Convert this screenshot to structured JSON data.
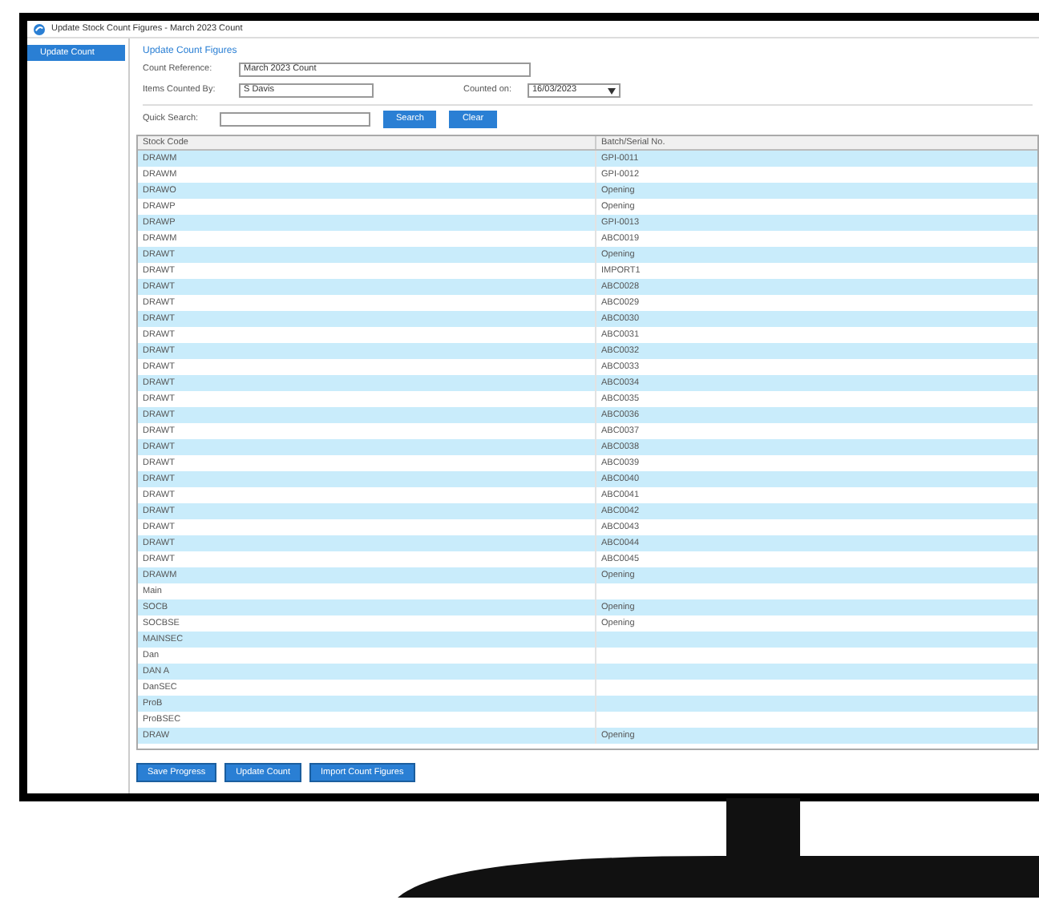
{
  "window": {
    "title": "Update Stock Count Figures - March 2023 Count"
  },
  "sidebar": {
    "items": [
      {
        "label": "Update Count",
        "selected": true
      }
    ]
  },
  "form": {
    "heading": "Update Count Figures",
    "count_reference": {
      "label": "Count Reference:",
      "value": "March 2023 Count"
    },
    "items_counted_by": {
      "label": "Items Counted By:",
      "value": "S Davis"
    },
    "counted_on": {
      "label": "Counted on:",
      "value": "16/03/2023"
    },
    "quick_search": {
      "label": "Quick Search:"
    },
    "buttons": [
      "Search",
      "Clear"
    ]
  },
  "table": {
    "columns": [
      "Stock Code",
      "Batch/Serial No."
    ],
    "rows": [
      [
        "DRAWM",
        "GPI-0011"
      ],
      [
        "DRAWM",
        "GPI-0012"
      ],
      [
        "DRAWO",
        "Opening"
      ],
      [
        "DRAWP",
        "Opening"
      ],
      [
        "DRAWP",
        "GPI-0013"
      ],
      [
        "DRAWM",
        "ABC0019"
      ],
      [
        "DRAWT",
        "Opening"
      ],
      [
        "DRAWT",
        "IMPORT1"
      ],
      [
        "DRAWT",
        "ABC0028"
      ],
      [
        "DRAWT",
        "ABC0029"
      ],
      [
        "DRAWT",
        "ABC0030"
      ],
      [
        "DRAWT",
        "ABC0031"
      ],
      [
        "DRAWT",
        "ABC0032"
      ],
      [
        "DRAWT",
        "ABC0033"
      ],
      [
        "DRAWT",
        "ABC0034"
      ],
      [
        "DRAWT",
        "ABC0035"
      ],
      [
        "DRAWT",
        "ABC0036"
      ],
      [
        "DRAWT",
        "ABC0037"
      ],
      [
        "DRAWT",
        "ABC0038"
      ],
      [
        "DRAWT",
        "ABC0039"
      ],
      [
        "DRAWT",
        "ABC0040"
      ],
      [
        "DRAWT",
        "ABC0041"
      ],
      [
        "DRAWT",
        "ABC0042"
      ],
      [
        "DRAWT",
        "ABC0043"
      ],
      [
        "DRAWT",
        "ABC0044"
      ],
      [
        "DRAWT",
        "ABC0045"
      ],
      [
        "DRAWM",
        "Opening"
      ],
      [
        "Main",
        null
      ],
      [
        "SOCB",
        "Opening"
      ],
      [
        "SOCBSE",
        "Opening"
      ],
      [
        "MAINSEC",
        null
      ],
      [
        "Dan",
        null
      ],
      [
        "DAN A",
        null
      ],
      [
        "DanSEC",
        null
      ],
      [
        "ProB",
        null
      ],
      [
        "ProBSEC",
        null
      ],
      [
        "DRAW",
        "Opening"
      ]
    ]
  },
  "footer_buttons": [
    "Save Progress",
    "Update Count",
    "Import Count Figures"
  ]
}
